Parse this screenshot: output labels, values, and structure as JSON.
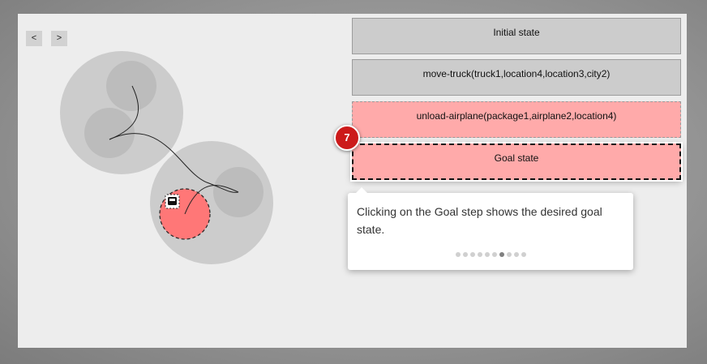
{
  "nav": {
    "prev_label": "<",
    "next_label": ">"
  },
  "steps": [
    {
      "label": "Initial state",
      "status": "neutral"
    },
    {
      "label": "move-truck(truck1,location4,location3,city2)",
      "status": "neutral"
    },
    {
      "label": "unload-airplane(package1,airplane2,location4)",
      "status": "failed"
    },
    {
      "label": "Goal state",
      "status": "goal"
    }
  ],
  "tour": {
    "step_number": "7",
    "text": "Clicking on the Goal step shows the desired goal state.",
    "total_steps": 10,
    "current_step": 7
  },
  "colors": {
    "step_neutral": "#cccccc",
    "step_failed": "#ffaaaa",
    "highlight_location": "#ff7777",
    "badge": "#cc1a1a",
    "city": "#cccccc",
    "location": "#bcbcbc"
  },
  "visualization": {
    "cities": [
      "city-1",
      "city-2"
    ],
    "locations": [
      "location-1",
      "location-2",
      "location-3",
      "location-4"
    ],
    "objects": [
      "truck-icon"
    ]
  }
}
